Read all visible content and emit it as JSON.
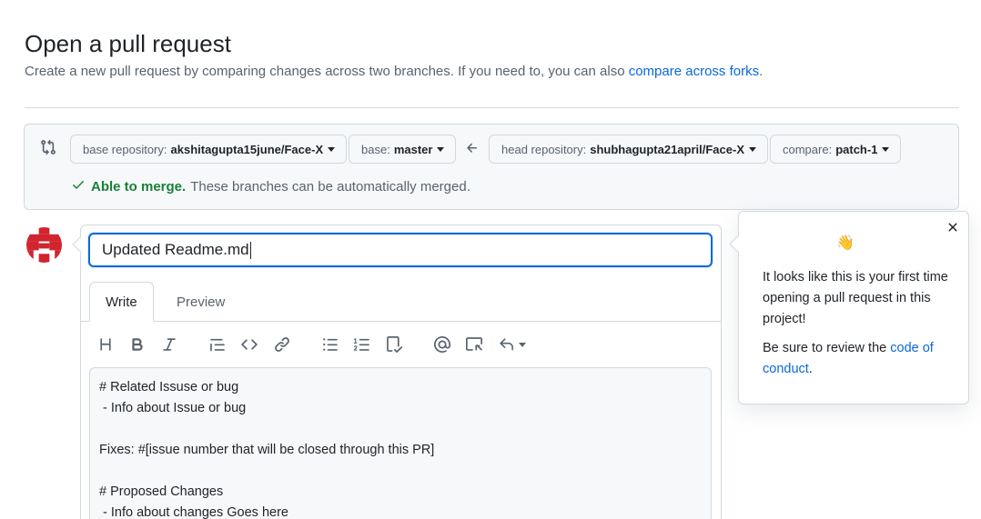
{
  "page": {
    "title": "Open a pull request",
    "subtitle": "Create a new pull request by comparing changes across two branches. If you need to, you can also ",
    "subtitle_link": "compare across forks",
    "subtitle_end": "."
  },
  "compare": {
    "base_repo_label": "base repository:",
    "base_repo_value": "akshitagupta15june/Face-X",
    "base_label": "base:",
    "base_value": "master",
    "head_repo_label": "head repository:",
    "head_repo_value": "shubhagupta21april/Face-X",
    "compare_label": "compare:",
    "compare_value": "patch-1",
    "merge_ok": "Able to merge.",
    "merge_text": "These branches can be automatically merged."
  },
  "form": {
    "title_value": "Updated Readme.md",
    "tab_write": "Write",
    "tab_preview": "Preview",
    "body_text": "# Related Issuse or bug\n - Info about Issue or bug\n\nFixes: #[issue number that will be closed through this PR]\n\n# Proposed Changes\n - Info about changes Goes here"
  },
  "toolbar": {
    "icons": [
      "heading-icon",
      "bold-icon",
      "italic-icon",
      "quote-icon",
      "code-icon",
      "link-icon",
      "unordered-list-icon",
      "ordered-list-icon",
      "task-list-icon",
      "mention-icon",
      "reference-icon",
      "reply-icon"
    ]
  },
  "popover": {
    "emoji": "👋",
    "text": "It looks like this is your first time opening a pull request in this project!",
    "text2": "Be sure to review the ",
    "link": "code of conduct",
    "text2_end": "."
  },
  "colors": {
    "accent": "#0969da",
    "success": "#1a7f37",
    "avatar": "#d1242f"
  }
}
